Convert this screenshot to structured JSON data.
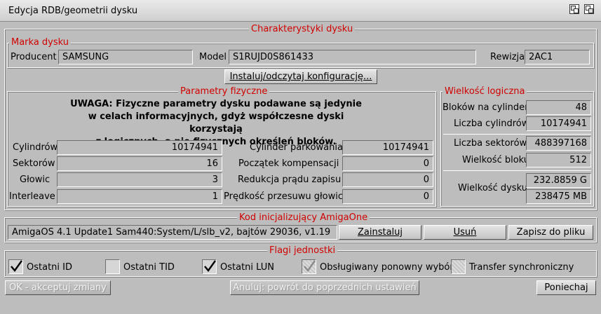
{
  "window": {
    "title": "Edycja RDB/geometrii dysku"
  },
  "characteristics": {
    "legend": "Charakterystyki dysku",
    "brand": {
      "legend": "Marka dysku",
      "producer_label": "Producent",
      "producer_value": "SAMSUNG",
      "model_label": "Model",
      "model_value": "S1RUJD0S861433",
      "revision_label": "Rewizja",
      "revision_value": "2AC1"
    },
    "install_button": "Instaluj/odczytaj konfigurację..."
  },
  "physical": {
    "legend": "Parametry fizyczne",
    "warning_line1": "UWAGA: Fizyczne parametry dysku podawane są jedynie",
    "warning_line2": "w celach informacyjnych, gdyż współczesne dyski korzystają",
    "warning_line3": "z logicznych, a nie fizycznych określeń bloków.",
    "cylinders_label": "Cylindrów",
    "cylinders_value": "10174941",
    "sectors_label": "Sektorów",
    "sectors_value": "16",
    "heads_label": "Głowic",
    "heads_value": "3",
    "interleave_label": "Interleave",
    "interleave_value": "1",
    "park_label": "Cylinder parkowania",
    "park_value": "10174941",
    "comp_label": "Początek kompensacji",
    "comp_value": "0",
    "current_label": "Redukcja prądu zapisu",
    "current_value": "0",
    "speed_label": "Prędkość przesuwu głowic",
    "speed_value": "0"
  },
  "logical": {
    "legend": "Wielkość logiczna",
    "blocks_per_cyl_label": "Bloków na cylinder",
    "blocks_per_cyl_value": "48",
    "cyl_count_label": "Liczba cylindrów",
    "cyl_count_value": "10174941",
    "sectors_count_label": "Liczba sektorów",
    "sectors_count_value": "488397168",
    "block_size_label": "Wielkość bloku",
    "block_size_value": "512",
    "disk_size_label": "Wielkość dysku",
    "disk_size_gb": "232.8859 G",
    "disk_size_mb": "238475 MB"
  },
  "amigaone": {
    "legend": "Kod inicjalizujący AmigaOne",
    "code_value": "AmigaOS 4.1 Update1 Sam440:System/L/slb_v2, bajtów 29036, v1.19",
    "install_button": "Zainstaluj",
    "remove_button": "Usuń",
    "save_button": "Zapisz do pliku"
  },
  "flags": {
    "legend": "Flagi jednostki",
    "last_id": {
      "label": "Ostatni ID",
      "checked": true
    },
    "last_tid": {
      "label": "Ostatni TID",
      "checked": false
    },
    "last_lun": {
      "label": "Ostatni LUN",
      "checked": true
    },
    "reselect": {
      "label": "Obsługiwany ponowny wybór",
      "checked": true,
      "disabled": true
    },
    "sync": {
      "label": "Transfer synchroniczny",
      "checked": false,
      "disabled": true
    }
  },
  "footer": {
    "ok_button": "OK - akceptuj zmiany",
    "cancel_button": "Anuluj: powrót do poprzednich ustawień",
    "abort_button": "Poniechaj"
  }
}
